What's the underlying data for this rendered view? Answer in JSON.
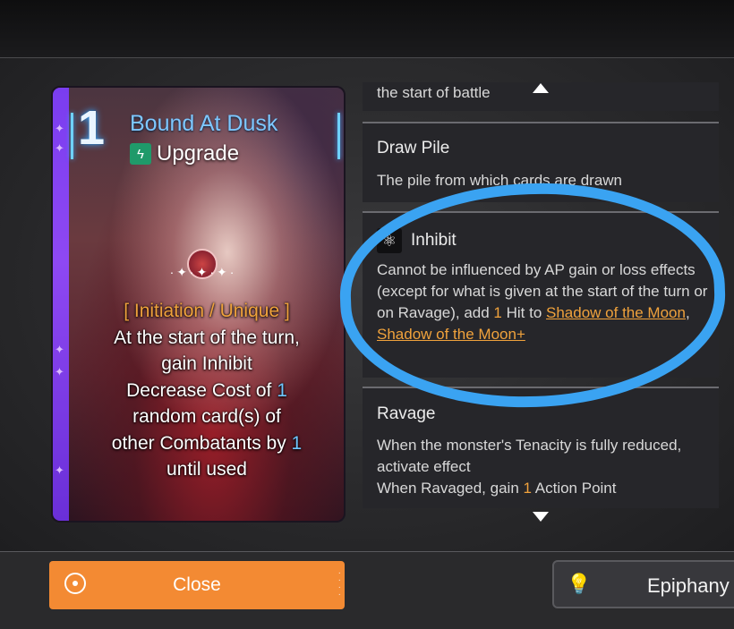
{
  "card": {
    "cost": "1",
    "title": "Bound At Dusk",
    "type_label": "Upgrade",
    "tag": "[ Initiation / Unique ]",
    "effect": {
      "line1": "At the start of the turn,",
      "line2": "gain Inhibit",
      "line3_pre": "Decrease Cost of ",
      "line3_num": "1",
      "line4": "random card(s) of",
      "line5_pre": "other Combatants by ",
      "line5_num": "1",
      "line6": "until used"
    },
    "strip_color": "#8e48f3",
    "title_color": "#7ec7ff",
    "icons": [
      "lightning-icon",
      "seal-emblem-icon"
    ]
  },
  "keywords": {
    "prev_desc": "the start of battle",
    "draw_pile": {
      "title": "Draw Pile",
      "desc": "The pile from which cards are drawn"
    },
    "inhibit": {
      "title": "Inhibit",
      "desc_pre": "Cannot be influenced by AP gain or loss effects (except for what is given at the start of the turn or on Ravage), add ",
      "desc_num": "1",
      "desc_mid": " Hit to ",
      "link1": "Shadow of the Moon",
      "desc_sep": ", ",
      "link2": "Shadow of the Moon+",
      "icon": "atom-icon"
    },
    "ravage": {
      "title": "Ravage",
      "desc1": "When the monster's Tenacity is fully reduced, activate effect",
      "desc2_pre": "When Ravaged, gain ",
      "desc2_num": "1",
      "desc2_post": " Action Point"
    },
    "highlight_color": "#3aa3f2"
  },
  "buttons": {
    "close": "Close",
    "epiphany": "Epiphany"
  },
  "colors": {
    "accent": "#f38a33",
    "keyword": "#f0a23c",
    "number_blue": "#6fc6ff"
  }
}
